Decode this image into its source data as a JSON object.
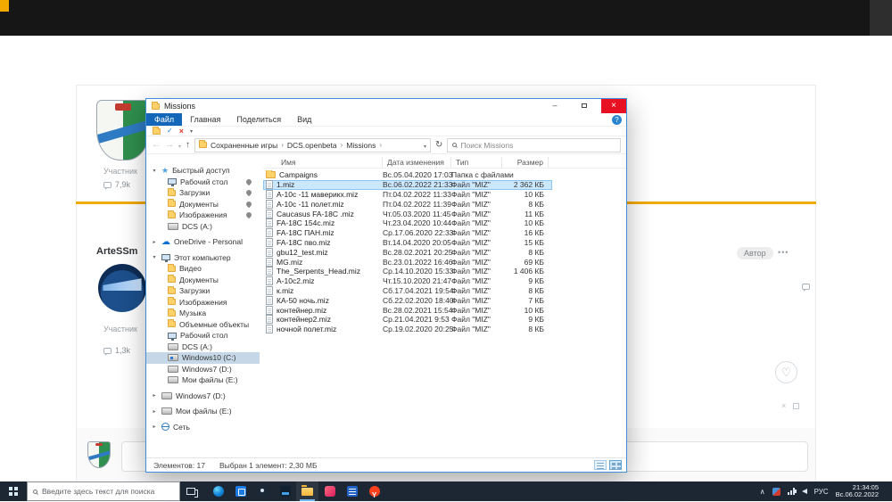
{
  "site": {
    "post_top": {
      "role": "Участник",
      "comments": "7,9k"
    },
    "post_main": {
      "username": "ArteSSm",
      "role": "Участник",
      "comments": "1,3k",
      "badge": "Автор",
      "more": "•••"
    }
  },
  "explorer": {
    "title": "Missions",
    "ribbon": {
      "tabs": [
        {
          "label": "Файл",
          "active": true
        },
        {
          "label": "Главная"
        },
        {
          "label": "Поделиться"
        },
        {
          "label": "Вид"
        }
      ],
      "help": "?"
    },
    "address": {
      "crumbs": [
        "Сохраненные игры",
        "DCS.openbeta",
        "Missions"
      ],
      "search_placeholder": "Поиск Missions"
    },
    "columns": [
      "Имя",
      "Дата изменения",
      "Тип",
      "Размер"
    ],
    "files": [
      {
        "name": "Campaigns",
        "date": "Вс.05.04.2020 17:03",
        "type": "Папка с файлами",
        "size": "",
        "icon": "folder"
      },
      {
        "name": "1.miz",
        "date": "Вс.06.02.2022 21:33",
        "type": "Файл \"MIZ\"",
        "size": "2 362 КБ",
        "icon": "file",
        "selected": true
      },
      {
        "name": "А-10с -11 маверикх.miz",
        "date": "Пт.04.02.2022 11:33",
        "type": "Файл \"MIZ\"",
        "size": "10 КБ",
        "icon": "file"
      },
      {
        "name": "А-10с -11 полет.miz",
        "date": "Пт.04.02.2022 11:39",
        "type": "Файл \"MIZ\"",
        "size": "8 КБ",
        "icon": "file"
      },
      {
        "name": "Caucasus FA-18C .miz",
        "date": "Чт.05.03.2020 11:45",
        "type": "Файл \"MIZ\"",
        "size": "11 КБ",
        "icon": "file"
      },
      {
        "name": "FA-18C 154c.miz",
        "date": "Чт.23.04.2020 10:44",
        "type": "Файл \"MIZ\"",
        "size": "10 КБ",
        "icon": "file"
      },
      {
        "name": "FA-18C ПАН.miz",
        "date": "Ср.17.06.2020 22:33",
        "type": "Файл \"MIZ\"",
        "size": "16 КБ",
        "icon": "file"
      },
      {
        "name": "FA-18C пво.miz",
        "date": "Вт.14.04.2020 20:05",
        "type": "Файл \"MIZ\"",
        "size": "15 КБ",
        "icon": "file"
      },
      {
        "name": "gbu12_test.miz",
        "date": "Вс.28.02.2021 20:25",
        "type": "Файл \"MIZ\"",
        "size": "8 КБ",
        "icon": "file"
      },
      {
        "name": "MG.miz",
        "date": "Вс.23.01.2022 16:46",
        "type": "Файл \"MIZ\"",
        "size": "69 КБ",
        "icon": "file"
      },
      {
        "name": "The_Serpents_Head.miz",
        "date": "Ср.14.10.2020 15:33",
        "type": "Файл \"MIZ\"",
        "size": "1 406 КБ",
        "icon": "file"
      },
      {
        "name": "А-10с2.miz",
        "date": "Чт.15.10.2020 21:47",
        "type": "Файл \"MIZ\"",
        "size": "9 КБ",
        "icon": "file"
      },
      {
        "name": "к.miz",
        "date": "Сб.17.04.2021 19:54",
        "type": "Файл \"MIZ\"",
        "size": "8 КБ",
        "icon": "file"
      },
      {
        "name": "КА-50 ночь.miz",
        "date": "Сб.22.02.2020 18:40",
        "type": "Файл \"MIZ\"",
        "size": "7 КБ",
        "icon": "file"
      },
      {
        "name": "контейнер.miz",
        "date": "Вс.28.02.2021 15:54",
        "type": "Файл \"MIZ\"",
        "size": "10 КБ",
        "icon": "file"
      },
      {
        "name": "контейнер2.miz",
        "date": "Ср.21.04.2021 9:53",
        "type": "Файл \"MIZ\"",
        "size": "9 КБ",
        "icon": "file"
      },
      {
        "name": "ночной полет.miz",
        "date": "Ср.19.02.2020 20:25",
        "type": "Файл \"MIZ\"",
        "size": "8 КБ",
        "icon": "file"
      }
    ],
    "sidebar": [
      {
        "label": "Быстрый доступ",
        "icon": "star",
        "chevron": "down",
        "root": true
      },
      {
        "label": "Рабочий стол",
        "icon": "desktop",
        "child": true,
        "pinned": true
      },
      {
        "label": "Загрузки",
        "icon": "downloads",
        "child": true,
        "pinned": true
      },
      {
        "label": "Документы",
        "icon": "documents",
        "child": true,
        "pinned": true
      },
      {
        "label": "Изображения",
        "icon": "pictures",
        "child": true,
        "pinned": true
      },
      {
        "label": "DCS (A:)",
        "icon": "drive",
        "child": true
      },
      {
        "label": "OneDrive - Personal",
        "icon": "cloud",
        "chevron": "right",
        "root": true,
        "gap": true
      },
      {
        "label": "Этот компьютер",
        "icon": "computer",
        "chevron": "down",
        "root": true,
        "gap": true
      },
      {
        "label": "Видео",
        "icon": "videos",
        "child": true
      },
      {
        "label": "Документы",
        "icon": "documents",
        "child": true
      },
      {
        "label": "Загрузки",
        "icon": "downloads",
        "child": true
      },
      {
        "label": "Изображения",
        "icon": "pictures",
        "child": true
      },
      {
        "label": "Музыка",
        "icon": "music",
        "child": true
      },
      {
        "label": "Объемные объекты",
        "icon": "objects3d",
        "child": true
      },
      {
        "label": "Рабочий стол",
        "icon": "desktop",
        "child": true
      },
      {
        "label": "DCS (A:)",
        "icon": "drive",
        "child": true
      },
      {
        "label": "Windows10 (C:)",
        "icon": "drive-win",
        "child": true,
        "selected": true
      },
      {
        "label": "Windows7 (D:)",
        "icon": "drive",
        "child": true
      },
      {
        "label": "Мои файлы (E:)",
        "icon": "drive",
        "child": true
      },
      {
        "label": "Windows7 (D:)",
        "icon": "drive",
        "chevron": "right",
        "root": true,
        "gap": true
      },
      {
        "label": "Мои файлы (E:)",
        "icon": "drive",
        "chevron": "right",
        "root": true,
        "gap": true
      },
      {
        "label": "Сеть",
        "icon": "network",
        "chevron": "right",
        "root": true,
        "gap": true
      }
    ],
    "status": {
      "items": "Элементов: 17",
      "selection": "Выбран 1 элемент: 2,30 МБ"
    }
  },
  "taskbar": {
    "search_placeholder": "Введите здесь текст для поиска",
    "apps": [
      {
        "name": "edge"
      },
      {
        "name": "blue-app"
      },
      {
        "name": "round-dark-app"
      },
      {
        "name": "dark-app"
      },
      {
        "name": "explorer",
        "open": true
      },
      {
        "name": "pink-app"
      },
      {
        "name": "blue-doc-app"
      },
      {
        "name": "yandex"
      }
    ],
    "tray": {
      "lang": "РУС",
      "time": "21:34:05",
      "date": "Вс.06.02.2022"
    }
  }
}
